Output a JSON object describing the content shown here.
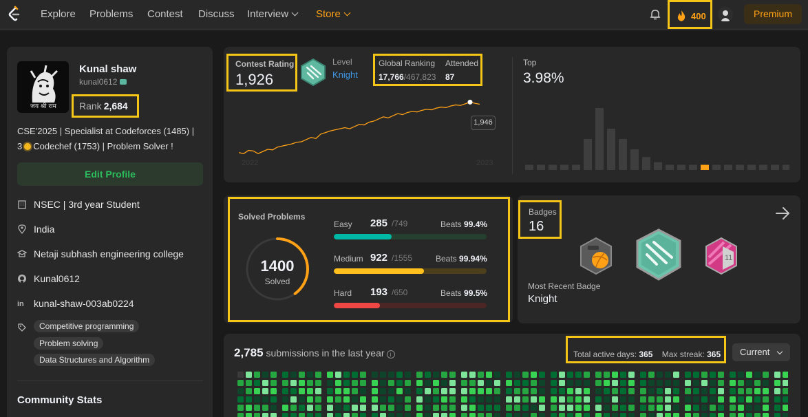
{
  "nav": {
    "items": [
      "Explore",
      "Problems",
      "Contest",
      "Discuss",
      "Interview",
      "Store"
    ],
    "streak": "400",
    "premium": "Premium"
  },
  "profile": {
    "name": "Kunal shaw",
    "handle": "kunal0612",
    "avatar_caption": "जय श्री राम",
    "rank_label": "Rank",
    "rank_value": "2,684",
    "bio_line1": "CSE'2025 | Specialist at Codeforces (1485) |",
    "bio_line2_pre": "3",
    "bio_line2_post": "Codechef (1753) | Problem Solver !",
    "edit_label": "Edit Profile",
    "info": [
      {
        "icon": "building-icon",
        "text": "NSEC | 3rd year Student"
      },
      {
        "icon": "location-icon",
        "text": "India"
      },
      {
        "icon": "school-icon",
        "text": "Netaji subhash engineering college"
      },
      {
        "icon": "github-icon",
        "text": "Kunal0612"
      },
      {
        "icon": "linkedin-icon",
        "text": "kunal-shaw-003ab0224"
      }
    ],
    "skills": [
      "Competitive programming",
      "Problem solving",
      "Data Structures and Algorithm"
    ],
    "community_title": "Community Stats"
  },
  "contest": {
    "rating_label": "Contest Rating",
    "rating_value": "1,926",
    "level_label": "Level",
    "level_value": "Knight",
    "global_label": "Global Ranking",
    "global_value": "17,766",
    "global_total": "/467,823",
    "attended_label": "Attended",
    "attended_value": "87",
    "top_label": "Top",
    "top_value": "3.98%",
    "tooltip": "1,946",
    "year_start": "2022",
    "year_end": "2023",
    "line": [
      1480,
      1470,
      1500,
      1495,
      1470,
      1490,
      1510,
      1505,
      1530,
      1540,
      1550,
      1560,
      1575,
      1580,
      1600,
      1620,
      1610,
      1650,
      1665,
      1680,
      1690,
      1700,
      1710,
      1700,
      1720,
      1740,
      1735,
      1760,
      1770,
      1790,
      1810,
      1800,
      1820,
      1840,
      1830,
      1850,
      1860,
      1855,
      1870,
      1880,
      1875,
      1890,
      1900,
      1895,
      1910,
      1920,
      1915,
      1930,
      1946,
      1935,
      1926
    ],
    "histogram": [
      2,
      2,
      2,
      2,
      2,
      12,
      24,
      16,
      12,
      8,
      5,
      3,
      2,
      2,
      2,
      2,
      2,
      2,
      2,
      2,
      2,
      2,
      2
    ],
    "highlight_index": 15,
    "accent_color": "#ffa116"
  },
  "solved": {
    "label": "Solved Problems",
    "total": "1400",
    "total_label": "Solved",
    "fraction": 0.4,
    "rows": [
      {
        "name": "Easy",
        "count": "285",
        "total": "/749",
        "beats_label": "Beats",
        "beats": "99.4%",
        "fill": 0.38,
        "color": "#00b8a3",
        "track": "#264030"
      },
      {
        "name": "Medium",
        "count": "922",
        "total": "/1555",
        "beats_label": "Beats",
        "beats": "99.94%",
        "fill": 0.59,
        "color": "#ffc01e",
        "track": "#4d3f1b"
      },
      {
        "name": "Hard",
        "count": "193",
        "total": "/650",
        "beats_label": "Beats",
        "beats": "99.5%",
        "fill": 0.3,
        "color": "#ef4743",
        "track": "#4b2625"
      }
    ]
  },
  "badges": {
    "label": "Badges",
    "value": "16",
    "recent_label": "Most Recent Badge",
    "recent_value": "Knight"
  },
  "submissions": {
    "count": "2,785",
    "text": "submissions in the last year",
    "active_label": "Total active days:",
    "active_value": "365",
    "streak_label": "Max streak:",
    "streak_value": "365",
    "select": "Current"
  }
}
